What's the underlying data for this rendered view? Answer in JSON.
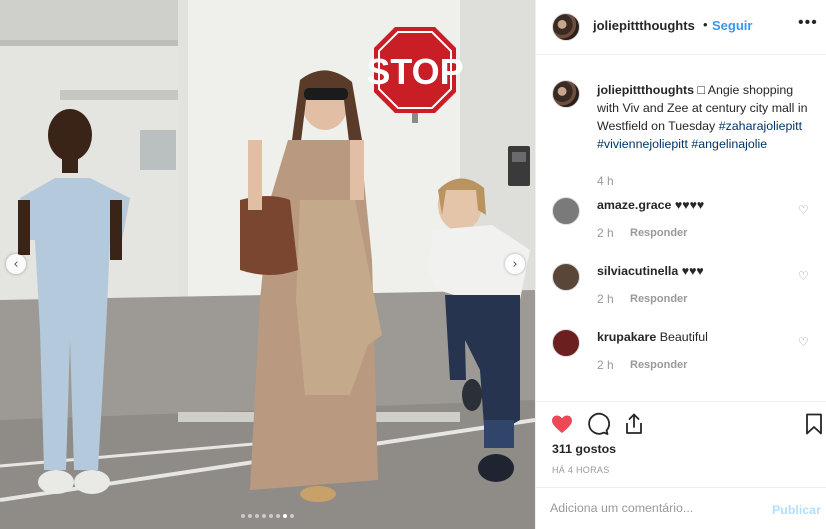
{
  "post": {
    "username": "joliepittthoughts",
    "separator": "•",
    "follow_label": "Seguir",
    "more_label": "•••"
  },
  "caption": {
    "username": "joliepittthoughts",
    "text": "□ Angie shopping with Viv and Zee at century city mall in Westfield on Tuesday",
    "hashtags": [
      "#zaharajoliepitt",
      "#viviennejoliepitt",
      "#angelinajolie"
    ],
    "time": "4 h"
  },
  "photo": {
    "sign_text": "STOP",
    "prev_label": "‹",
    "next_label": "›",
    "carousel_dots": 8,
    "active_dot": 6
  },
  "comments": [
    {
      "username": "amaze.grace",
      "text": "♥♥♥♥",
      "time": "2 h",
      "reply": "Responder",
      "avatar_color": "#7a7a7a"
    },
    {
      "username": "silviacutinella",
      "text": "♥♥♥",
      "time": "2 h",
      "reply": "Responder",
      "avatar_color": "#5a4638"
    },
    {
      "username": "krupakare",
      "text": "Beautiful",
      "time": "2 h",
      "reply": "Responder",
      "avatar_color": "#6b1f1f"
    }
  ],
  "actions": {
    "likes_text": "311 gostos",
    "time_ago": "HÁ 4 HORAS"
  },
  "add_comment": {
    "placeholder": "Adiciona um comentário...",
    "post_label": "Publicar"
  },
  "colors": {
    "accent": "#3897f0",
    "like_red": "#ed4956",
    "hashtag": "#003569",
    "muted": "#999999"
  }
}
